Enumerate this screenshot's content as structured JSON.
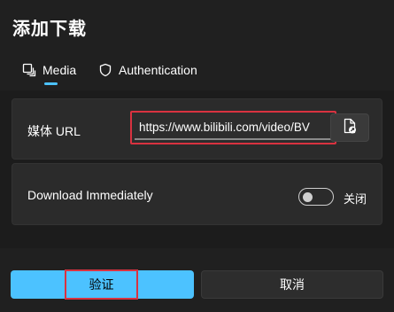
{
  "dialog": {
    "title": "添加下载"
  },
  "tabs": [
    {
      "label": "Media",
      "icon": "media-icon",
      "selected": true
    },
    {
      "label": "Authentication",
      "icon": "shield-icon",
      "selected": false
    }
  ],
  "url_row": {
    "label": "媒体 URL",
    "value": "https://www.bilibili.com/video/BV",
    "file_button_icon": "file-open-icon"
  },
  "download_row": {
    "label": "Download Immediately",
    "toggle_on": false,
    "toggle_state_label": "关闭"
  },
  "footer": {
    "verify_label": "验证",
    "cancel_label": "取消"
  },
  "colors": {
    "accent": "#4cc2ff",
    "highlight_border": "#d93240",
    "background": "#202020",
    "card": "#2b2b2b"
  }
}
